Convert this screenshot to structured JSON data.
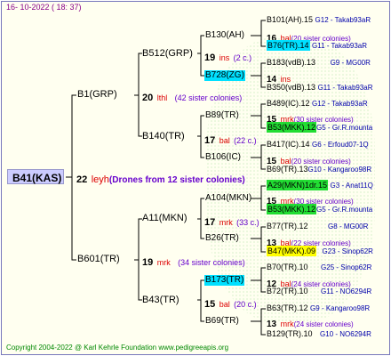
{
  "date": "16- 10-2022 ( 18: 37)",
  "copyright": "Copyright 2004-2022 @ Karl Kehrle Foundation    www.pedigreeapis.org",
  "root": {
    "name": "B41(KAS)",
    "count": "22",
    "breeder": "leyh",
    "sisters": "(Drones from 12 sister colonies)"
  },
  "gen1": [
    {
      "name": "B1(GRP)",
      "count": "20",
      "breeder": "lthl",
      "sisters": "(42 sister colonies)"
    },
    {
      "name": "B601(TR)",
      "count": "19",
      "breeder": "mrk",
      "sisters": "(34 sister colonies)"
    }
  ],
  "gen2": [
    {
      "name": "B512(GRP)",
      "count": "19",
      "breeder": "ins",
      "sisters": "(2 c.)"
    },
    {
      "name": "B140(TR)",
      "count": "17",
      "breeder": "bal",
      "sisters": "(22 c.)"
    },
    {
      "name": "A11(MKN)",
      "count": "17",
      "breeder": "mrk",
      "sisters": "(33 c.)"
    },
    {
      "name": "B43(TR)",
      "count": "15",
      "breeder": "bal",
      "sisters": "(20 c.)"
    }
  ],
  "gen3": [
    {
      "name": "B130(AH)",
      "count": "16",
      "breeder": "bal",
      "sisters": "(20 sister colonies)"
    },
    {
      "name": "B728(ZG)",
      "count": "14",
      "breeder": "ins",
      "sisters": ""
    },
    {
      "name": "B89(TR)",
      "count": "15",
      "breeder": "mrk",
      "sisters": "(30 sister colonies)"
    },
    {
      "name": "B106(IC)",
      "count": "15",
      "breeder": "bal",
      "sisters": "(20 sister colonies)"
    },
    {
      "name": "A104(MKN)",
      "count": "15",
      "breeder": "mrk",
      "sisters": "(30 sister colonies)"
    },
    {
      "name": "B26(TR)",
      "count": "13",
      "breeder": "bal",
      "sisters": "(22 sister colonies)"
    },
    {
      "name": "B173(TR)",
      "count": "12",
      "breeder": "bal",
      "sisters": "(24 sister colonies)"
    },
    {
      "name": "B69(TR)",
      "count": "13",
      "breeder": "mrk",
      "sisters": "(24 sister colonies)"
    }
  ],
  "gen4": [
    {
      "name": "B101(AH).15",
      "info": "G12 - Takab93aR"
    },
    {
      "name": "B76(TR).14",
      "info": "G11 - Takab93aR"
    },
    {
      "name": "B183(vdB).13",
      "info": "G9 - MG00R"
    },
    {
      "name": "B350(vdB).13",
      "info": "G11 - Takab93aR"
    },
    {
      "name": "B489(IC).12",
      "info": "G12 - Takab93aR"
    },
    {
      "name": "B53(MKK).12",
      "info": "G5 - Gr.R.mounta"
    },
    {
      "name": "B417(IC).14",
      "info": "G6 - Erfoud07-1Q"
    },
    {
      "name": "B69(TR).13",
      "info": "G10 - Kangaroo98R"
    },
    {
      "name": "A29(MKN)1dr.15",
      "info": "G3 - Anat11Q"
    },
    {
      "name": "B53(MKK).12",
      "info": "G5 - Gr.R.mounta"
    },
    {
      "name": "B77(TR).12",
      "info": "G8 - MG00R"
    },
    {
      "name": "B47(MKK).09",
      "info": "G23 - Sinop62R"
    },
    {
      "name": "B70(TR).10",
      "info": "G25 - Sinop62R"
    },
    {
      "name": "B72(TR).10",
      "info": "G11 - NO6294R"
    },
    {
      "name": "B63(TR).12",
      "info": "G9 - Kangaroo98R"
    },
    {
      "name": "B129(TR).10",
      "info": "G10 - NO6294R"
    }
  ]
}
